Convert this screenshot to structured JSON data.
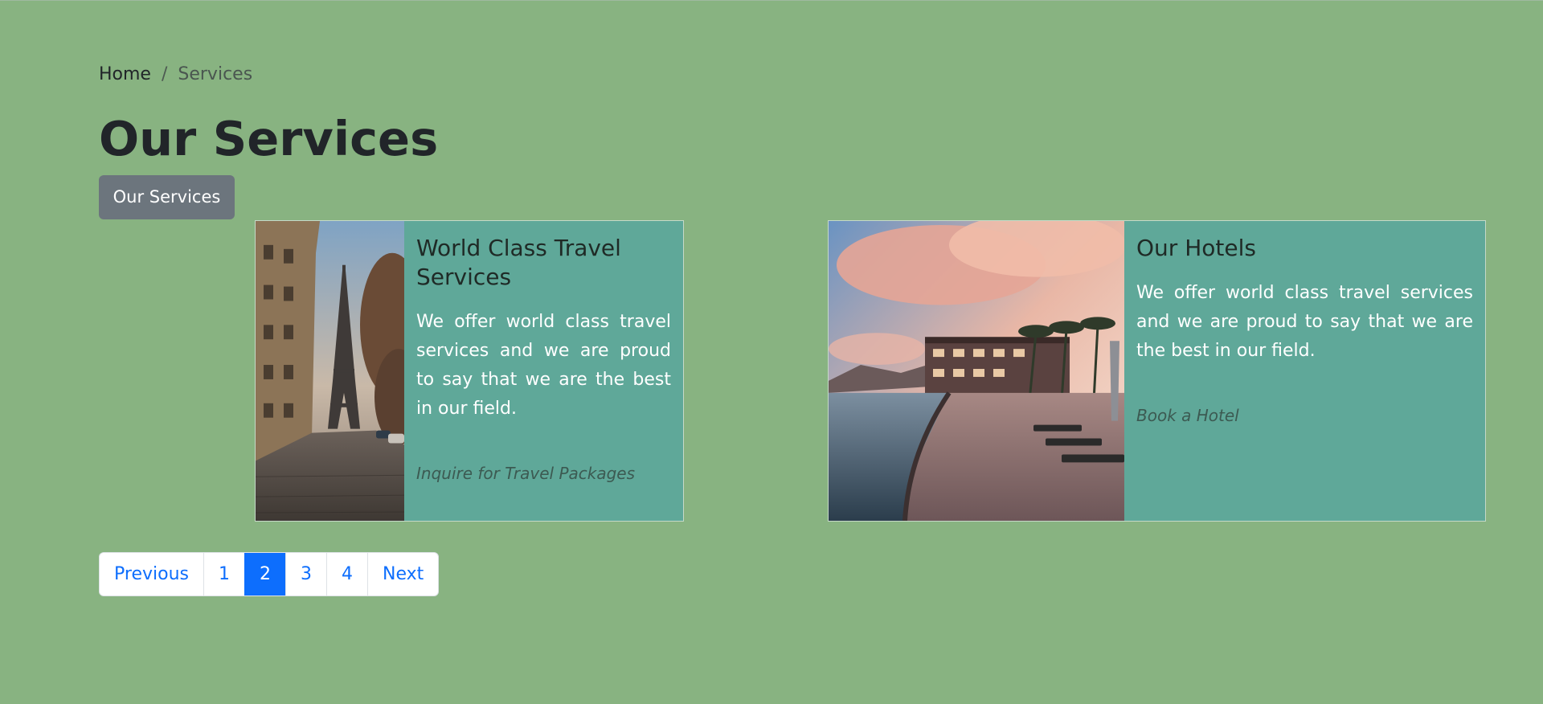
{
  "breadcrumb": {
    "home": "Home",
    "separator": "/",
    "current": "Services"
  },
  "page": {
    "title": "Our Services",
    "section_badge": "Our Services"
  },
  "cards": [
    {
      "title": "World Class Travel Services",
      "text": "We offer world class travel services and we are proud to say that we are the best in our field.",
      "link": "Inquire for Travel Packages",
      "image": "eiffel-tower-street-photo"
    },
    {
      "title": "Our Hotels",
      "text": "We offer world class travel services and we are proud to say that we are the best in our field.",
      "link": "Book a Hotel",
      "image": "resort-hotel-sunset-photo"
    }
  ],
  "pagination": {
    "previous": "Previous",
    "pages": [
      "1",
      "2",
      "3",
      "4"
    ],
    "active_page": "2",
    "next": "Next"
  },
  "colors": {
    "background": "#88b381",
    "card_background": "#5fa899",
    "badge_background": "#6c757d",
    "accent": "#0d6efd"
  }
}
